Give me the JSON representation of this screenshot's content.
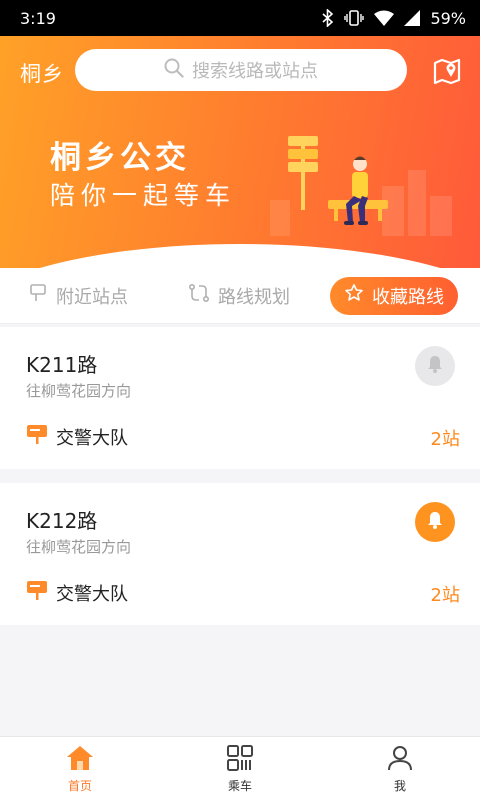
{
  "status_bar": {
    "time": "3:19",
    "battery": "59%"
  },
  "header": {
    "city": "桐乡",
    "search_placeholder": "搜索线路或站点"
  },
  "hero": {
    "title": "桐乡公交",
    "subtitle": "陪你一起等车"
  },
  "tabs": [
    {
      "label": "附近站点",
      "icon": "signpost-icon",
      "active": false
    },
    {
      "label": "路线规划",
      "icon": "route-icon",
      "active": false
    },
    {
      "label": "收藏路线",
      "icon": "star-icon",
      "active": true
    }
  ],
  "routes": [
    {
      "name": "K211路",
      "direction": "往柳莺花园方向",
      "stop": "交警大队",
      "stops_away": "2站",
      "reminder_on": false
    },
    {
      "name": "K212路",
      "direction": "往柳莺花园方向",
      "stop": "交警大队",
      "stops_away": "2站",
      "reminder_on": true
    }
  ],
  "nav": [
    {
      "label": "首页",
      "icon": "home-icon",
      "active": true
    },
    {
      "label": "乘车",
      "icon": "qr-code-icon",
      "active": false
    },
    {
      "label": "我",
      "icon": "person-icon",
      "active": false
    }
  ],
  "colors": {
    "accent": "#ff7a2a",
    "accent_light": "#ffa127",
    "stops_text": "#ff8a1f"
  }
}
